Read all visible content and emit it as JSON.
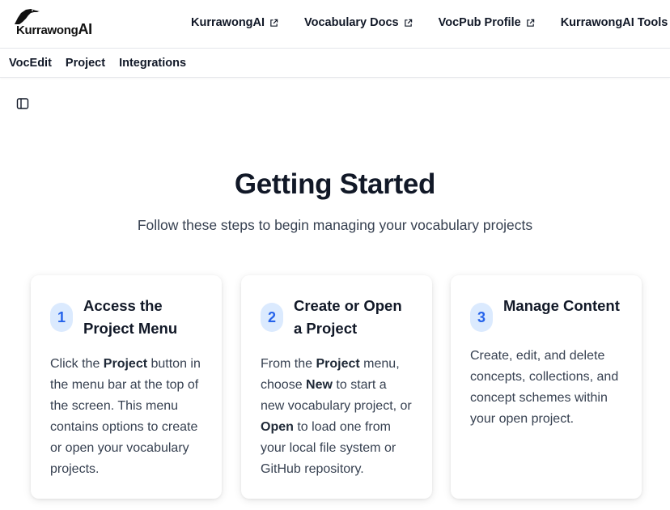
{
  "header": {
    "logo_text": "Kurrawong",
    "logo_suffix": "AI",
    "links": [
      {
        "label": "KurrawongAI"
      },
      {
        "label": "Vocabulary Docs"
      },
      {
        "label": "VocPub Profile"
      },
      {
        "label": "KurrawongAI Tools"
      }
    ]
  },
  "menubar": {
    "items": [
      {
        "label": "VocEdit"
      },
      {
        "label": "Project"
      },
      {
        "label": "Integrations"
      }
    ]
  },
  "main": {
    "title": "Getting Started",
    "subtitle": "Follow these steps to begin managing your vocabulary projects",
    "steps": [
      {
        "number": "1",
        "title": "Access the Project Menu",
        "body": [
          {
            "text": "Click the "
          },
          {
            "text": "Project",
            "bold": true
          },
          {
            "text": " button in the menu bar at the top of the screen. This menu contains options to create or open your vocabulary projects."
          }
        ]
      },
      {
        "number": "2",
        "title": "Create or Open a Project",
        "body": [
          {
            "text": "From the "
          },
          {
            "text": "Project",
            "bold": true
          },
          {
            "text": " menu, choose "
          },
          {
            "text": "New",
            "bold": true
          },
          {
            "text": " to start a new vocabulary project, or "
          },
          {
            "text": "Open",
            "bold": true
          },
          {
            "text": " to load one from your local file system or GitHub repository."
          }
        ]
      },
      {
        "number": "3",
        "title": "Manage Content",
        "body": [
          {
            "text": "Create, edit, and delete concepts, collections, and concept schemes within your open project."
          }
        ]
      }
    ]
  },
  "colors": {
    "accent": "#2563eb",
    "badge_bg": "#dbeafe",
    "heading": "#111827",
    "body_text": "#374151"
  },
  "icons": {
    "external_link": "external-link-icon",
    "sidebar_toggle": "sidebar-toggle-icon",
    "logo_bird": "bird-logo-icon"
  }
}
